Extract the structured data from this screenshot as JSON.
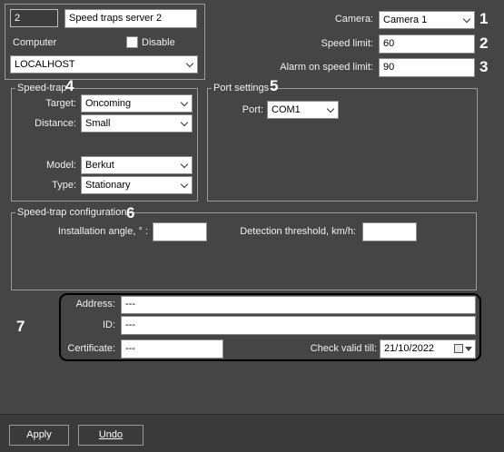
{
  "general": {
    "id_value": "2",
    "name_value": "Speed traps server 2",
    "computer_label": "Computer",
    "disable_label": "Disable",
    "computer_value": "LOCALHOST"
  },
  "camera": {
    "camera_label": "Camera:",
    "camera_value": "Camera 1",
    "speed_limit_label": "Speed limit:",
    "speed_limit_value": "60",
    "alarm_label": "Alarm on speed limit:",
    "alarm_value": "90"
  },
  "speed_trap": {
    "legend": "Speed-trap",
    "target_label": "Target:",
    "target_value": "Oncoming",
    "distance_label": "Distance:",
    "distance_value": "Small",
    "model_label": "Model:",
    "model_value": "Berkut",
    "type_label": "Type:",
    "type_value": "Stationary"
  },
  "port_settings": {
    "legend": "Port settings",
    "port_label": "Port:",
    "port_value": "COM1"
  },
  "configuration": {
    "legend": "Speed-trap configuration",
    "angle_label": "Installation angle, ° :",
    "angle_value": "",
    "threshold_label": "Detection threshold, km/h:",
    "threshold_value": ""
  },
  "address_block": {
    "address_label": "Address:",
    "address_value": "---",
    "id_label": "ID:",
    "id_value": "---",
    "certificate_label": "Certificate:",
    "certificate_value": "---",
    "check_valid_label": "Check valid till:",
    "check_valid_value": "21/10/2022"
  },
  "callouts": [
    "1",
    "2",
    "3",
    "4",
    "5",
    "6",
    "7"
  ],
  "footer": {
    "apply_label": "Apply",
    "undo_label": "Undo"
  }
}
